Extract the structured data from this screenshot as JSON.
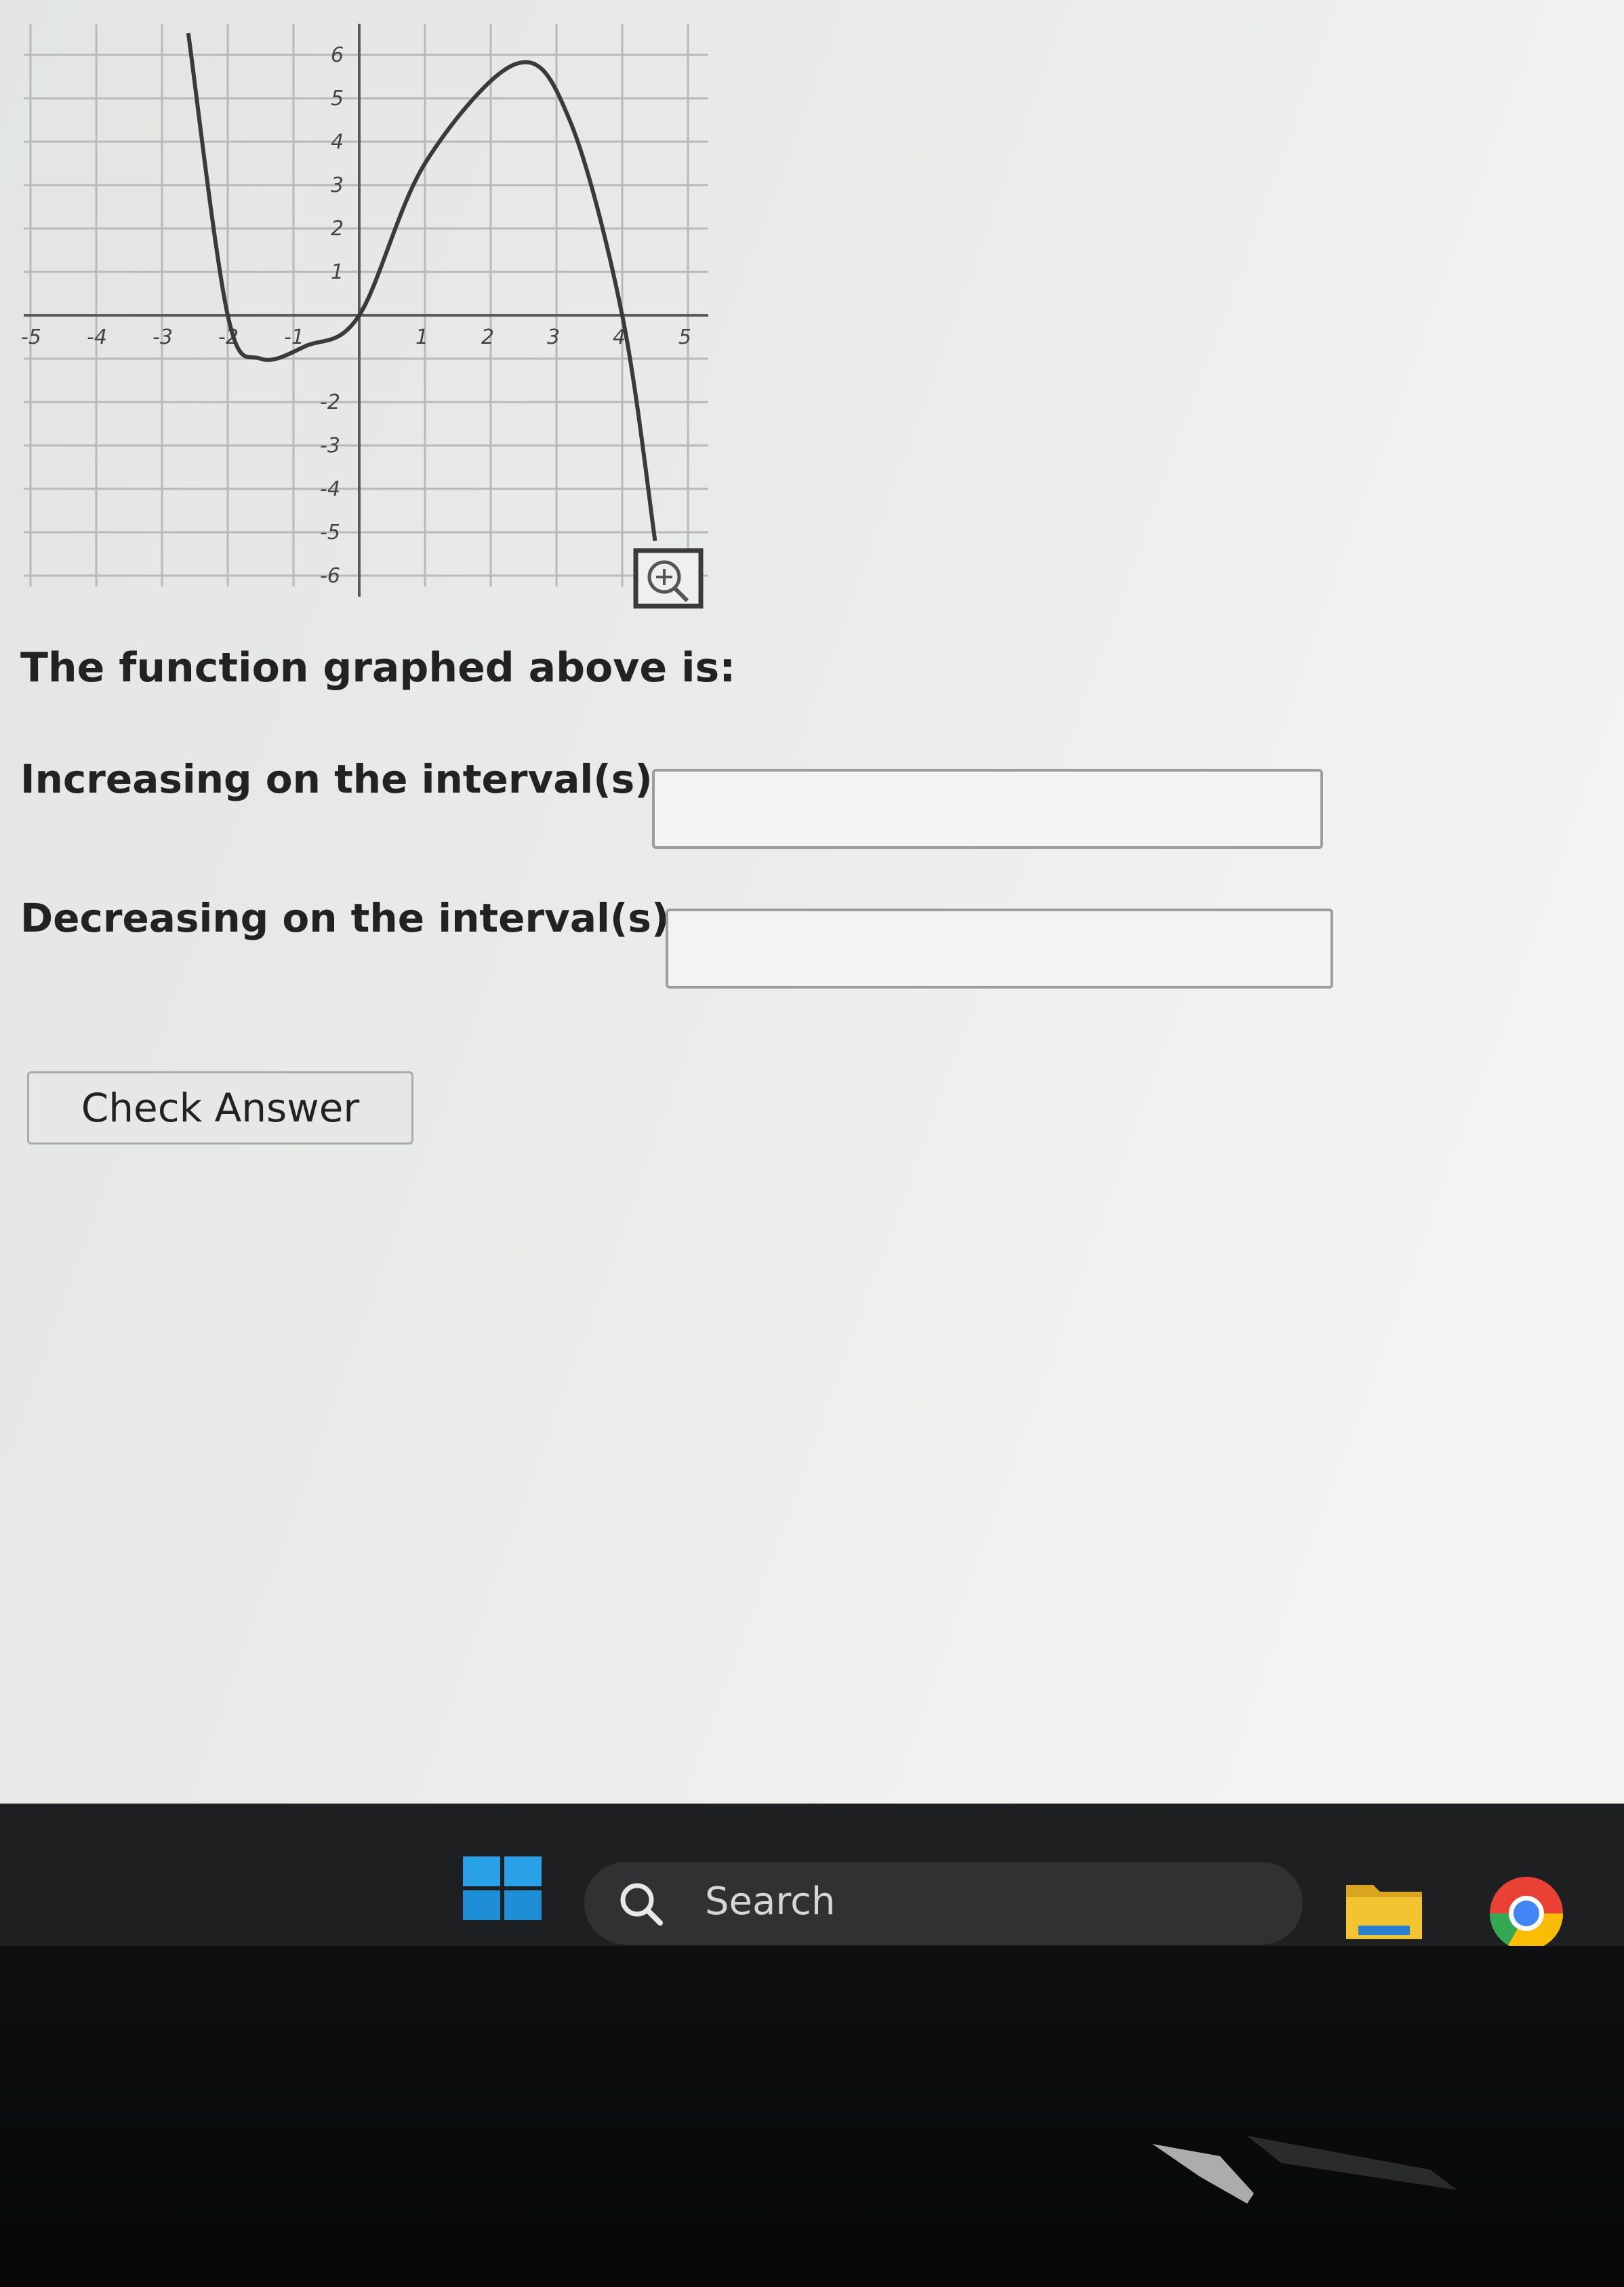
{
  "graph": {
    "x_tick_labels": [
      "-5",
      "-4",
      "-3",
      "-2",
      "-1",
      "1",
      "2",
      "3",
      "4",
      "5"
    ],
    "y_tick_labels_pos": [
      "6",
      "5",
      "4",
      "3",
      "2",
      "1"
    ],
    "y_tick_labels_neg": [
      "-2",
      "-3",
      "-4",
      "-5",
      "-6"
    ],
    "curve_points": [
      [
        -2.6,
        6.5
      ],
      [
        -2.0,
        0
      ],
      [
        -1.5,
        -1.0
      ],
      [
        -0.8,
        -0.7
      ],
      [
        0,
        0
      ],
      [
        1.0,
        3.5
      ],
      [
        2.4,
        5.8
      ],
      [
        3.2,
        4.5
      ],
      [
        4.0,
        0
      ],
      [
        4.5,
        -5.2
      ]
    ],
    "magnify_icon": "magnify-icon"
  },
  "question": {
    "prompt": "The function graphed above is:",
    "increasing_label": "Increasing on the interval(s)",
    "increasing_value": "",
    "decreasing_label": "Decreasing on the interval(s)",
    "decreasing_value": "",
    "check_button": "Check Answer"
  },
  "taskbar": {
    "start_icon": "windows-start-icon",
    "search_placeholder": "Search",
    "search_icon": "search-icon",
    "apps": [
      "file-explorer-icon",
      "chrome-icon"
    ],
    "colors": {
      "taskbar_bg": "#1d1f21",
      "windows_blue": "#2aa0e6",
      "folder_yellow": "#f3c431"
    }
  }
}
